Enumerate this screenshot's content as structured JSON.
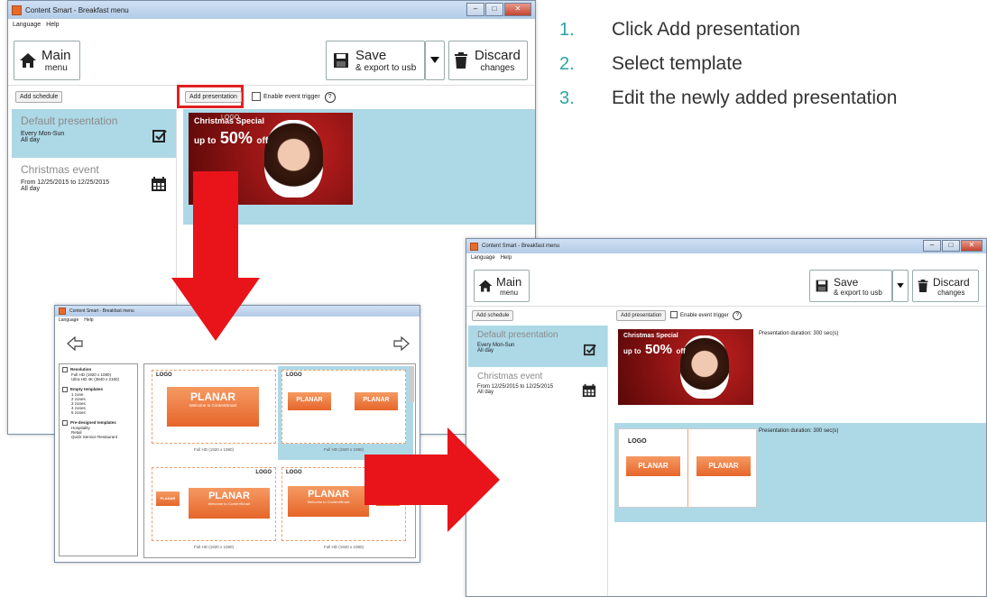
{
  "window_main": {
    "title": "Content Smart - Breakfast menu",
    "menu": [
      "Language",
      "Help"
    ],
    "main_btn": {
      "label": "Main",
      "sub": "menu"
    },
    "save_btn": {
      "label": "Save",
      "sub": "& export to usb"
    },
    "discard_btn": {
      "label": "Discard",
      "sub": "changes"
    },
    "add_schedule": "Add schedule",
    "add_presentation": "Add presentation",
    "enable_trigger": "Enable event trigger",
    "help_glyph": "?",
    "schedules": [
      {
        "title": "Default presentation",
        "line1": "Every Mon-Sun",
        "line2": "All day",
        "icon": "checkmark-icon"
      },
      {
        "title": "Christmas event",
        "line1": "From 12/25/2015 to 12/25/2015",
        "line2": "All day",
        "icon": "calendar-icon"
      }
    ],
    "poster": {
      "line1": "Christmas Special",
      "line2_prefix": "up to",
      "line2_big": "50%",
      "line2_suffix": "off",
      "logo": "LOGO"
    }
  },
  "window_template": {
    "title": "Content Smart - Breakfast menu",
    "menu": [
      "Language",
      "Help"
    ],
    "resolution_header": "Resolution",
    "resolution_options": [
      "Full HD (1920 x 1080)",
      "Ultra HD 4K (3840 x 2160)"
    ],
    "empty_header": "Empty templates",
    "empty_options": [
      "1 zone",
      "2 zones",
      "3 zones",
      "4 zones",
      "5 zones"
    ],
    "predesigned_header": "Pre-designed templates",
    "predesigned_options": [
      "Hospitality",
      "Retail",
      "Quick Service Restaurant"
    ],
    "templates": [
      {
        "caption": "Full HD (1920 x 1080)",
        "brand": "PLANAR",
        "logo": "LOGO",
        "tagline": "Welcome to ContentSmart"
      },
      {
        "caption": "Full HD (1920 x 1080)",
        "brand": "PLANAR",
        "logo": "LOGO",
        "tagline": ""
      },
      {
        "caption": "Full HD (1920 x 1080)",
        "brand": "PLANAR",
        "logo": "LOGO",
        "tagline": "Welcome to ContentSmart",
        "side": "PLANAR"
      },
      {
        "caption": "Full HD (1920 x 1080)",
        "brand": "PLANAR",
        "logo": "LOGO",
        "tagline": "Welcome to ContentSmart",
        "side": "PLANAR"
      }
    ]
  },
  "window_result": {
    "title": "Content Smart - Breakfast menu",
    "menu": [
      "Language",
      "Help"
    ],
    "main_btn": {
      "label": "Main",
      "sub": "menu"
    },
    "save_btn": {
      "label": "Save",
      "sub": "& export to usb"
    },
    "discard_btn": {
      "label": "Discard",
      "sub": "changes"
    },
    "add_schedule": "Add schedule",
    "add_presentation": "Add presentation",
    "enable_trigger": "Enable event trigger",
    "help_glyph": "?",
    "schedules": [
      {
        "title": "Default presentation",
        "line1": "Every Mon-Sun",
        "line2": "All day"
      },
      {
        "title": "Christmas event",
        "line1": "From 12/25/2015 to 12/25/2015",
        "line2": "All day"
      }
    ],
    "presentations": [
      {
        "duration": "Presentation duration: 300 sec(s)"
      },
      {
        "duration": "Presentation duration: 300 sec(s)",
        "brand": "PLANAR",
        "logo": "LOGO"
      }
    ]
  },
  "steps": [
    {
      "num": "1.",
      "text": "Click Add presentation"
    },
    {
      "num": "2.",
      "text": "Select template"
    },
    {
      "num": "3.",
      "text": "Edit the newly added presentation"
    }
  ],
  "colors": {
    "accent": "#2aa6a2",
    "highlight": "#e02020",
    "selected": "#add8e6",
    "arrow": "#e8141a"
  }
}
